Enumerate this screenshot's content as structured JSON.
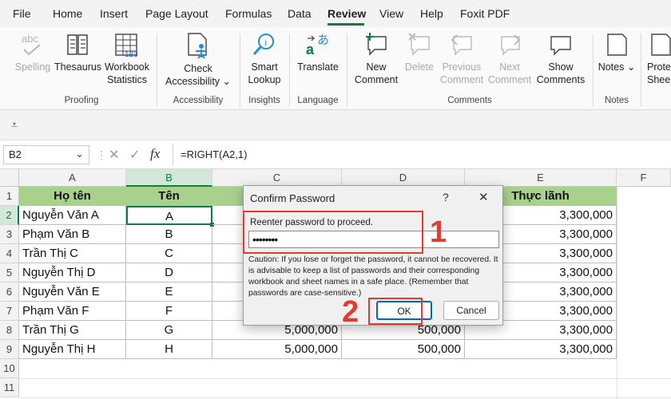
{
  "menu": {
    "items": [
      "File",
      "Home",
      "Insert",
      "Page Layout",
      "Formulas",
      "Data",
      "Review",
      "View",
      "Help",
      "Foxit PDF"
    ],
    "active": "Review"
  },
  "ribbon": {
    "groups": {
      "proofing": "Proofing",
      "accessibility": "Accessibility",
      "insights": "Insights",
      "language": "Language",
      "comments": "Comments",
      "notes": "Notes"
    },
    "buttons": {
      "spelling": "Spelling",
      "thesaurus": "Thesaurus",
      "workbook_stats_1": "Workbook",
      "workbook_stats_2": "Statistics",
      "check_acc_1": "Check",
      "check_acc_2": "Accessibility",
      "smart_lookup_1": "Smart",
      "smart_lookup_2": "Lookup",
      "translate": "Translate",
      "new_comment_1": "New",
      "new_comment_2": "Comment",
      "delete": "Delete",
      "previous_1": "Previous",
      "previous_2": "Comment",
      "next_1": "Next",
      "next_2": "Comment",
      "show_1": "Show",
      "show_2": "Comments",
      "notes": "Notes",
      "protect_1": "Prote",
      "protect_2": "Shee"
    }
  },
  "formula": {
    "name_box": "B2",
    "fx": "fx",
    "content": "=RIGHT(A2,1)"
  },
  "grid": {
    "columns": [
      "A",
      "B",
      "C",
      "D",
      "E",
      "F"
    ],
    "rows": [
      "1",
      "2",
      "3",
      "4",
      "5",
      "6",
      "7",
      "8",
      "9",
      "10",
      "11"
    ],
    "header_A": "Họ tên",
    "header_B": "Tên",
    "header_E": "Thực lãnh",
    "names": [
      "Nguyễn Văn A",
      "Phạm Văn B",
      "Trần Thị C",
      "Nguyễn Thị D",
      "Nguyễn Văn E",
      "Phạm Văn F",
      "Trần Thị G",
      "Nguyễn Thị H"
    ],
    "letters": [
      "A",
      "B",
      "C",
      "D",
      "E",
      "F",
      "G",
      "H"
    ],
    "col_c_visible": [
      "5,000,000",
      "5,000,000"
    ],
    "col_d_visible": [
      "500,000",
      "500,000"
    ],
    "col_e": [
      "3,300,000",
      "3,300,000",
      "3,300,000",
      "3,300,000",
      "3,300,000",
      "3,300,000",
      "3,300,000",
      "3,300,000"
    ]
  },
  "dialog": {
    "title": "Confirm Password",
    "help": "?",
    "close": "✕",
    "prompt": "Reenter password to proceed.",
    "password_mask": "••••••••",
    "caution": "Caution: If you lose or forget the password, it cannot be recovered. It is advisable to keep a list of passwords and their corresponding workbook and sheet names in a safe place. (Remember that passwords are case-sensitive.)",
    "ok": "OK",
    "cancel": "Cancel"
  },
  "annotations": {
    "step1": "1",
    "step2": "2"
  },
  "colors": {
    "accent": "#107c41",
    "header_fill": "#a9d18e",
    "annotation": "#e23b2f"
  }
}
